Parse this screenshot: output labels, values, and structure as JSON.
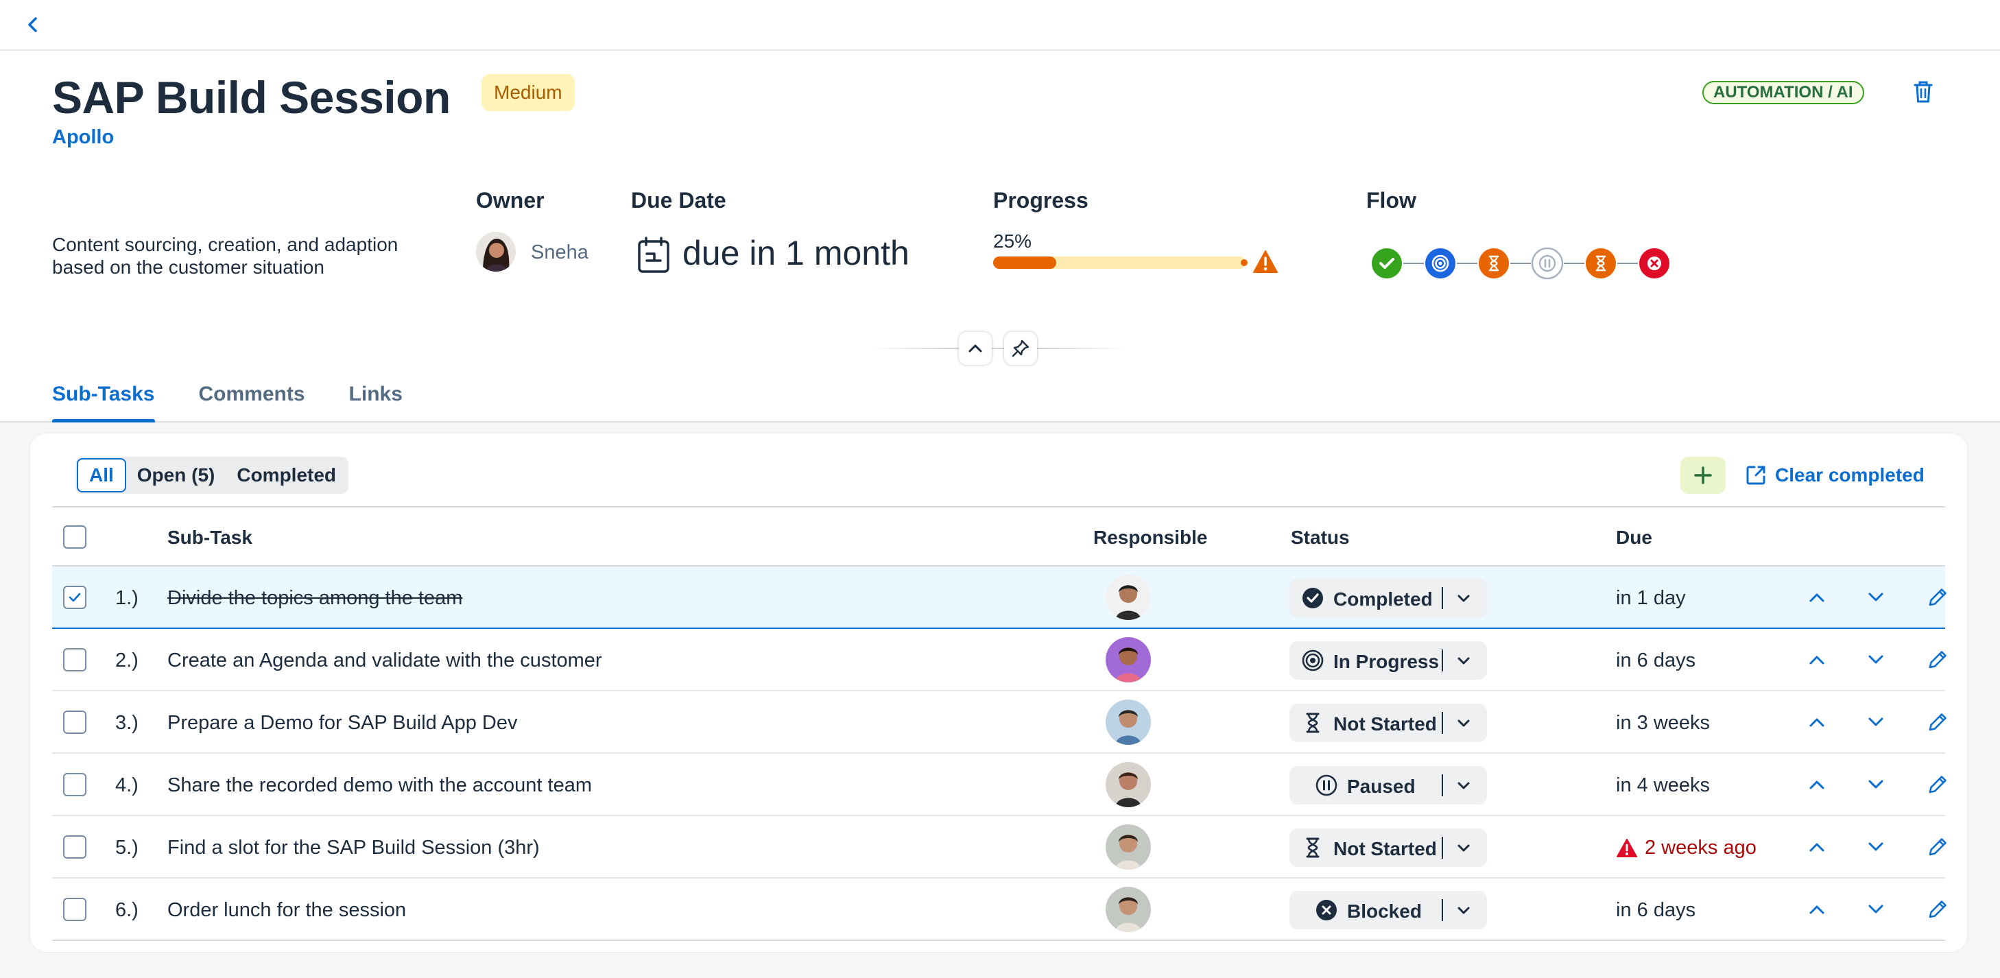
{
  "header": {
    "title": "SAP Build Session",
    "priority": "Medium",
    "project": "Apollo",
    "category": "AUTOMATION / AI",
    "description": "Content sourcing, creation, and adaption based on the customer situation",
    "owner_label": "Owner",
    "owner_name": "Sneha",
    "due_label": "Due Date",
    "due_text": "due in 1 month",
    "progress_label": "Progress",
    "progress_text": "25%",
    "progress_value": 25,
    "flow_label": "Flow",
    "flow": [
      "completed",
      "in-progress",
      "not-started",
      "paused",
      "not-started",
      "blocked"
    ]
  },
  "tabs": [
    "Sub-Tasks",
    "Comments",
    "Links"
  ],
  "filters": {
    "all": "All",
    "open": "Open (5)",
    "completed": "Completed"
  },
  "toolbar": {
    "clear_label": "Clear completed"
  },
  "table": {
    "headers": {
      "subtask": "Sub-Task",
      "responsible": "Responsible",
      "status": "Status",
      "due": "Due"
    },
    "rows": [
      {
        "num": "1.)",
        "task": "Divide the topics among the team",
        "status": "Completed",
        "due": "in 1 day",
        "checked": true
      },
      {
        "num": "2.)",
        "task": "Create an Agenda and validate with the customer",
        "status": "In Progress",
        "due": "in 6 days",
        "checked": false
      },
      {
        "num": "3.)",
        "task": "Prepare a Demo for SAP Build App Dev",
        "status": "Not Started",
        "due": "in 3 weeks",
        "checked": false
      },
      {
        "num": "4.)",
        "task": "Share the recorded demo with the account team",
        "status": "Paused",
        "due": "in 4 weeks",
        "checked": false
      },
      {
        "num": "5.)",
        "task": "Find a slot for the SAP Build Session (3hr)",
        "status": "Not Started",
        "due": "2 weeks ago",
        "checked": false
      },
      {
        "num": "6.)",
        "task": "Order lunch for the session",
        "status": "Blocked",
        "due": "in 6 days",
        "checked": false
      }
    ]
  },
  "colors": {
    "accent": "#0a6ed1",
    "completed": "#36a41d",
    "in_progress": "#1b65e0",
    "not_started": "#e76500",
    "paused": "#a9b4be",
    "blocked": "#e00b27"
  }
}
